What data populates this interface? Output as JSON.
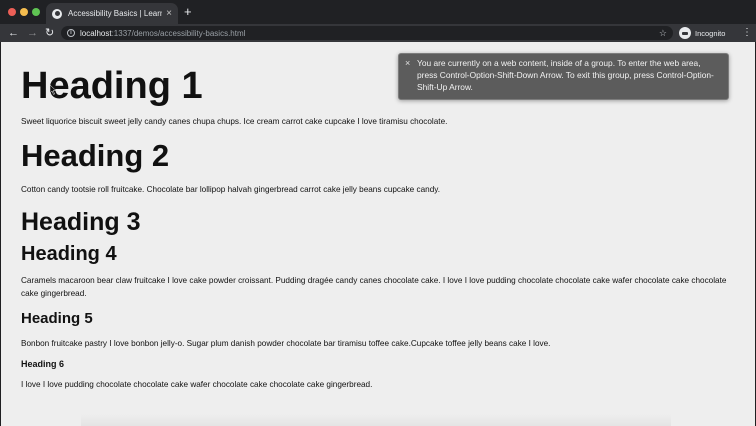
{
  "browser": {
    "tab_title": "Accessibility Basics | Learn Ho",
    "tab_close": "×",
    "new_tab": "+",
    "url_host": "localhost",
    "url_rest": ":1337/demos/accessibility-basics.html",
    "profile_label": "Incognito",
    "icons": [
      "back-icon",
      "forward-icon",
      "reload-icon",
      "info-icon",
      "star-icon",
      "incognito-icon",
      "menu-icon"
    ]
  },
  "page": {
    "heading1": "Heading 1",
    "p1": "Sweet liquorice biscuit sweet jelly candy canes chupa chups. Ice cream carrot cake cupcake I love tiramisu chocolate.",
    "heading2": "Heading 2",
    "p2": "Cotton candy tootsie roll fruitcake. Chocolate bar lollipop halvah gingerbread carrot cake jelly beans cupcake candy.",
    "heading3": "Heading 3",
    "heading4": "Heading 4",
    "p3": "Caramels macaroon bear claw fruitcake I love cake powder croissant. Pudding dragée candy canes chocolate cake. I love I love pudding chocolate chocolate cake wafer chocolate cake chocolate cake gingerbread.",
    "heading5": "Heading 5",
    "p4": "Bonbon fruitcake pastry I love bonbon jelly-o. Sugar plum danish powder chocolate bar tiramisu toffee cake.Cupcake toffee jelly beans cake I love.",
    "heading6": "Heading 6",
    "p5": "I love I love pudding chocolate chocolate cake wafer chocolate cake chocolate cake gingerbread."
  },
  "voiceover": {
    "close": "×",
    "message": "You are currently on a web content, inside of a group. To enter the web area, press Control-Option-Shift-Down Arrow.  To exit this group, press Control-Option-Shift-Up Arrow."
  }
}
